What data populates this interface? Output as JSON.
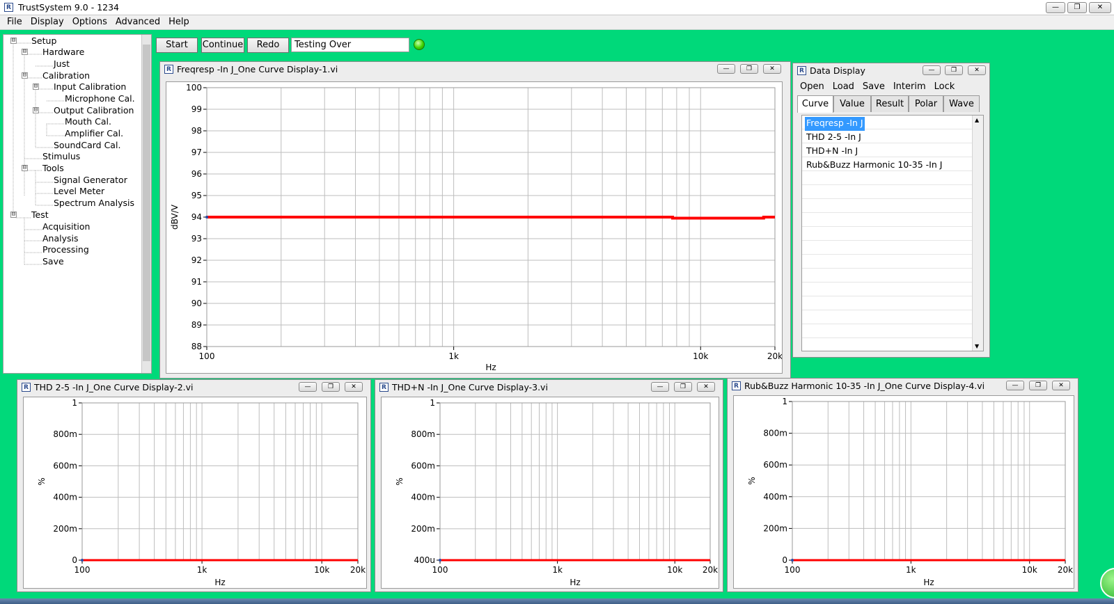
{
  "app": {
    "title": "TrustSystem 9.0 - 1234",
    "icon": "app-icon",
    "window_controls": [
      "minimize-icon",
      "restore-icon",
      "close-icon"
    ]
  },
  "menu": [
    "File",
    "Display",
    "Options",
    "Advanced",
    "Help"
  ],
  "tree": [
    {
      "label": "Setup",
      "expander": "⊟"
    },
    {
      "label": "Hardware",
      "expander": "⊟"
    },
    {
      "label": "Just"
    },
    {
      "label": "Calibration",
      "expander": "⊟"
    },
    {
      "label": "Input Calibration",
      "expander": "⊟"
    },
    {
      "label": "Microphone Cal."
    },
    {
      "label": "Output Calibration",
      "expander": "⊟"
    },
    {
      "label": "Mouth Cal."
    },
    {
      "label": "Amplifier Cal."
    },
    {
      "label": "SoundCard Cal."
    },
    {
      "label": "Stimulus"
    },
    {
      "label": "Tools",
      "expander": "⊟"
    },
    {
      "label": "Signal Generator"
    },
    {
      "label": "Level Meter"
    },
    {
      "label": "Spectrum Analysis"
    },
    {
      "label": "Test",
      "expander": "⊟"
    },
    {
      "label": "Acquisition"
    },
    {
      "label": "Analysis"
    },
    {
      "label": "Processing"
    },
    {
      "label": "Save"
    }
  ],
  "toolbar": {
    "start": "Start",
    "continue": "Continue",
    "redo": "Redo",
    "status": "Testing Over",
    "led_color": "#3ed400"
  },
  "data_display": {
    "title": "Data Display",
    "menu": [
      "Open",
      "Load",
      "Save",
      "Interim",
      "Lock"
    ],
    "tabs": [
      "Curve",
      "Value",
      "Result",
      "Polar",
      "Wave"
    ],
    "active_tab": "Curve",
    "items": [
      {
        "label": "Freqresp -In J",
        "selected": true
      },
      {
        "label": "THD 2-5 -In J",
        "selected": false
      },
      {
        "label": "THD+N -In J",
        "selected": false
      },
      {
        "label": "Rub&Buzz Harmonic 10-35 -In J",
        "selected": false
      }
    ]
  },
  "windows": {
    "w1": {
      "title": "Freqresp -In J_One Curve Display-1.vi"
    },
    "w2": {
      "title": "THD 2-5 -In J_One Curve Display-2.vi"
    },
    "w3": {
      "title": "THD+N -In J_One Curve Display-3.vi"
    },
    "w4": {
      "title": "Rub&Buzz Harmonic 10-35 -In J_One Curve Display-4.vi"
    }
  },
  "colors": {
    "background": "#00d97a",
    "curve": "#ff0000",
    "selection": "#3399ff"
  },
  "chart_data": [
    {
      "type": "line",
      "xscale": "log",
      "xlim": [
        100,
        20000
      ],
      "ylim": [
        88,
        100
      ],
      "xticks": [
        100,
        1000,
        10000,
        20000
      ],
      "xtick_labels": [
        "100",
        "1k",
        "10k",
        "20k"
      ],
      "yticks": [
        88,
        89,
        90,
        91,
        92,
        93,
        94,
        95,
        96,
        97,
        98,
        99,
        100
      ],
      "ytick_labels": [
        "88",
        "89",
        "90",
        "91",
        "92",
        "93",
        "94",
        "95",
        "96",
        "97",
        "98",
        "99",
        "100"
      ],
      "xlabel": "Hz",
      "ylabel": "dBV/V",
      "grid": true,
      "series": [
        {
          "color": "#ff0000",
          "x": [
            100,
            1000,
            7700,
            7700,
            18000,
            18000,
            20000
          ],
          "y": [
            94.0,
            94.0,
            94.0,
            93.95,
            93.95,
            94.0,
            94.0
          ]
        }
      ]
    },
    {
      "type": "line",
      "xscale": "log",
      "xlim": [
        100,
        20000
      ],
      "ylim": [
        0,
        1
      ],
      "xticks": [
        100,
        1000,
        10000,
        20000
      ],
      "xtick_labels": [
        "100",
        "1k",
        "10k",
        "20k"
      ],
      "yticks": [
        0,
        0.2,
        0.4,
        0.6,
        0.8,
        1
      ],
      "ytick_labels": [
        "0",
        "200m",
        "400m",
        "600m",
        "800m",
        "1"
      ],
      "xlabel": "Hz",
      "ylabel": "%",
      "grid": true,
      "series": [
        {
          "color": "#ff0000",
          "x": [
            100,
            20000
          ],
          "y": [
            0,
            0
          ]
        }
      ]
    },
    {
      "type": "line",
      "xscale": "log",
      "xlim": [
        100,
        20000
      ],
      "ylim": [
        0.0004,
        1
      ],
      "xticks": [
        100,
        1000,
        10000,
        20000
      ],
      "xtick_labels": [
        "100",
        "1k",
        "10k",
        "20k"
      ],
      "yticks": [
        0.0004,
        0.2,
        0.4,
        0.6,
        0.8,
        1
      ],
      "ytick_labels": [
        "400u",
        "200m",
        "400m",
        "600m",
        "800m",
        "1"
      ],
      "xlabel": "Hz",
      "ylabel": "%",
      "grid": true,
      "series": [
        {
          "color": "#ff0000",
          "x": [
            100,
            20000
          ],
          "y": [
            0.0004,
            0.0004
          ]
        }
      ]
    },
    {
      "type": "line",
      "xscale": "log",
      "xlim": [
        100,
        20000
      ],
      "ylim": [
        0,
        1
      ],
      "xticks": [
        100,
        1000,
        10000,
        20000
      ],
      "xtick_labels": [
        "100",
        "1k",
        "10k",
        "20k"
      ],
      "yticks": [
        0,
        0.2,
        0.4,
        0.6,
        0.8,
        1
      ],
      "ytick_labels": [
        "0",
        "200m",
        "400m",
        "600m",
        "800m",
        "1"
      ],
      "xlabel": "Hz",
      "ylabel": "%",
      "grid": true,
      "series": [
        {
          "color": "#ff0000",
          "x": [
            100,
            20000
          ],
          "y": [
            0,
            0
          ]
        }
      ]
    }
  ]
}
